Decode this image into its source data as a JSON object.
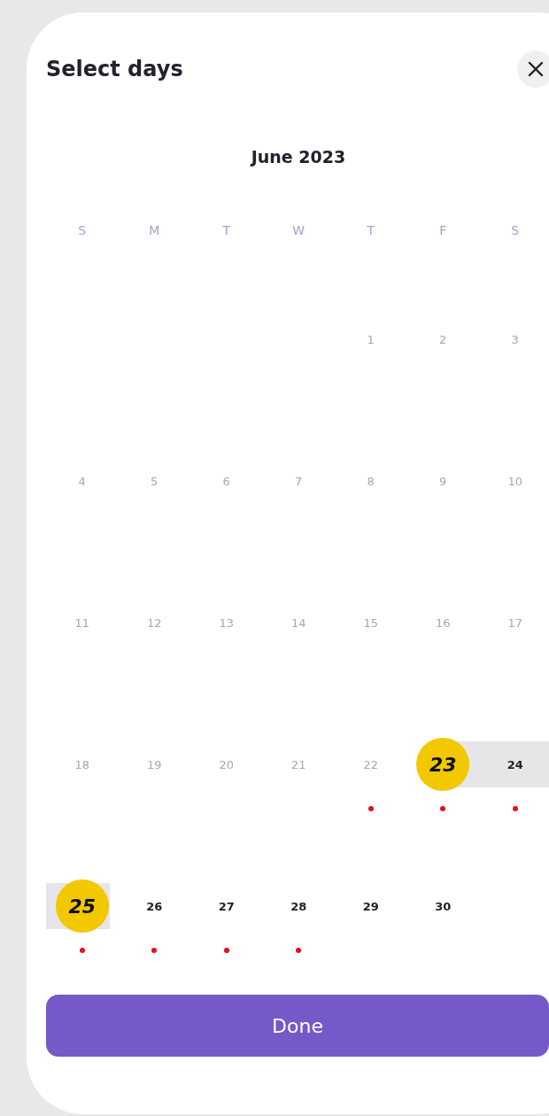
{
  "title": "Select days",
  "month": "June 2023",
  "weekdays": [
    "S",
    "M",
    "T",
    "W",
    "T",
    "F",
    "S"
  ],
  "weeks": [
    {
      "days": [
        {
          "kind": "blank"
        },
        {
          "kind": "blank"
        },
        {
          "kind": "blank"
        },
        {
          "kind": "blank"
        },
        {
          "kind": "day",
          "day": "1",
          "disabled": true,
          "selected": false,
          "in_range": false,
          "event": false
        },
        {
          "kind": "day",
          "day": "2",
          "disabled": true,
          "selected": false,
          "in_range": false,
          "event": false
        },
        {
          "kind": "day",
          "day": "3",
          "disabled": true,
          "selected": false,
          "in_range": false,
          "event": false
        }
      ]
    },
    {
      "days": [
        {
          "kind": "day",
          "day": "4",
          "disabled": true,
          "selected": false,
          "in_range": false,
          "event": false
        },
        {
          "kind": "day",
          "day": "5",
          "disabled": true,
          "selected": false,
          "in_range": false,
          "event": false
        },
        {
          "kind": "day",
          "day": "6",
          "disabled": true,
          "selected": false,
          "in_range": false,
          "event": false
        },
        {
          "kind": "day",
          "day": "7",
          "disabled": true,
          "selected": false,
          "in_range": false,
          "event": false
        },
        {
          "kind": "day",
          "day": "8",
          "disabled": true,
          "selected": false,
          "in_range": false,
          "event": false
        },
        {
          "kind": "day",
          "day": "9",
          "disabled": true,
          "selected": false,
          "in_range": false,
          "event": false
        },
        {
          "kind": "day",
          "day": "10",
          "disabled": true,
          "selected": false,
          "in_range": false,
          "event": false
        }
      ]
    },
    {
      "days": [
        {
          "kind": "day",
          "day": "11",
          "disabled": true,
          "selected": false,
          "in_range": false,
          "event": false
        },
        {
          "kind": "day",
          "day": "12",
          "disabled": true,
          "selected": false,
          "in_range": false,
          "event": false
        },
        {
          "kind": "day",
          "day": "13",
          "disabled": true,
          "selected": false,
          "in_range": false,
          "event": false
        },
        {
          "kind": "day",
          "day": "14",
          "disabled": true,
          "selected": false,
          "in_range": false,
          "event": false
        },
        {
          "kind": "day",
          "day": "15",
          "disabled": true,
          "selected": false,
          "in_range": false,
          "event": false
        },
        {
          "kind": "day",
          "day": "16",
          "disabled": true,
          "selected": false,
          "in_range": false,
          "event": false
        },
        {
          "kind": "day",
          "day": "17",
          "disabled": true,
          "selected": false,
          "in_range": false,
          "event": false
        }
      ]
    },
    {
      "days": [
        {
          "kind": "day",
          "day": "18",
          "disabled": true,
          "selected": false,
          "in_range": false,
          "event": false
        },
        {
          "kind": "day",
          "day": "19",
          "disabled": true,
          "selected": false,
          "in_range": false,
          "event": false
        },
        {
          "kind": "day",
          "day": "20",
          "disabled": true,
          "selected": false,
          "in_range": false,
          "event": false
        },
        {
          "kind": "day",
          "day": "21",
          "disabled": true,
          "selected": false,
          "in_range": false,
          "event": false
        },
        {
          "kind": "day",
          "day": "22",
          "disabled": true,
          "selected": false,
          "in_range": false,
          "event": true
        },
        {
          "kind": "day",
          "day": "23",
          "disabled": false,
          "selected": true,
          "in_range": true,
          "event": true
        },
        {
          "kind": "day",
          "day": "24",
          "disabled": false,
          "selected": false,
          "in_range": true,
          "event": true
        }
      ]
    },
    {
      "days": [
        {
          "kind": "day",
          "day": "25",
          "disabled": false,
          "selected": true,
          "in_range": true,
          "event": true
        },
        {
          "kind": "day",
          "day": "26",
          "disabled": false,
          "selected": false,
          "in_range": false,
          "event": true
        },
        {
          "kind": "day",
          "day": "27",
          "disabled": false,
          "selected": false,
          "in_range": false,
          "event": true
        },
        {
          "kind": "day",
          "day": "28",
          "disabled": false,
          "selected": false,
          "in_range": false,
          "event": true
        },
        {
          "kind": "day",
          "day": "29",
          "disabled": false,
          "selected": false,
          "in_range": false,
          "event": false
        },
        {
          "kind": "day",
          "day": "30",
          "disabled": false,
          "selected": false,
          "in_range": false,
          "event": false
        }
      ]
    }
  ],
  "done_button": "Done"
}
